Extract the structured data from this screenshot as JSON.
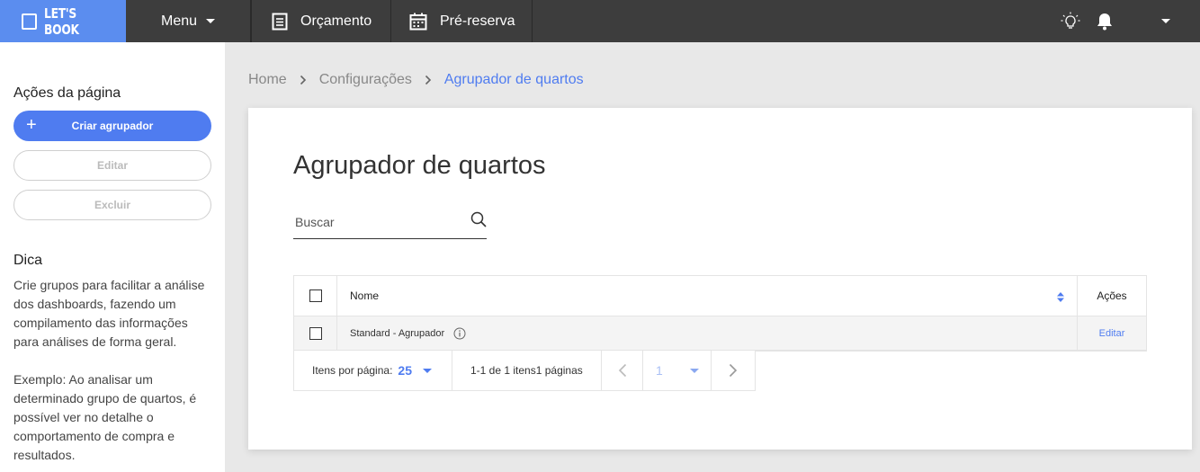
{
  "topbar": {
    "brand": "LET'S BOOK",
    "menu_label": "Menu",
    "orcamento_label": "Orçamento",
    "prereserva_label": "Pré-reserva"
  },
  "sidebar": {
    "actions_title": "Ações da página",
    "create_label": "Criar agrupador",
    "edit_label": "Editar",
    "delete_label": "Excluir",
    "tip_title": "Dica",
    "tip_paragraph_1": "Crie grupos para facilitar a análise dos dashboards, fazendo um compilamento das informações para análises de forma geral.",
    "tip_paragraph_2": "Exemplo: Ao analisar um determinado grupo de quartos, é possível ver no detalhe o comportamento de compra e resultados."
  },
  "breadcrumb": {
    "home": "Home",
    "settings": "Configurações",
    "current": "Agrupador de quartos"
  },
  "page": {
    "title": "Agrupador de quartos",
    "search_placeholder": "Buscar"
  },
  "table": {
    "columns": {
      "name": "Nome",
      "actions": "Ações"
    },
    "rows": [
      {
        "name": "Standard - Agrupador",
        "action": "Editar"
      }
    ]
  },
  "pagination": {
    "per_page_label": "Itens por página:",
    "per_page_value": "25",
    "range_text": "1-1 de 1 itens1 páginas",
    "current_page": "1"
  },
  "colors": {
    "accent": "#4f7cf0",
    "brand": "#5b8def",
    "topbar": "#3d3d3d"
  }
}
